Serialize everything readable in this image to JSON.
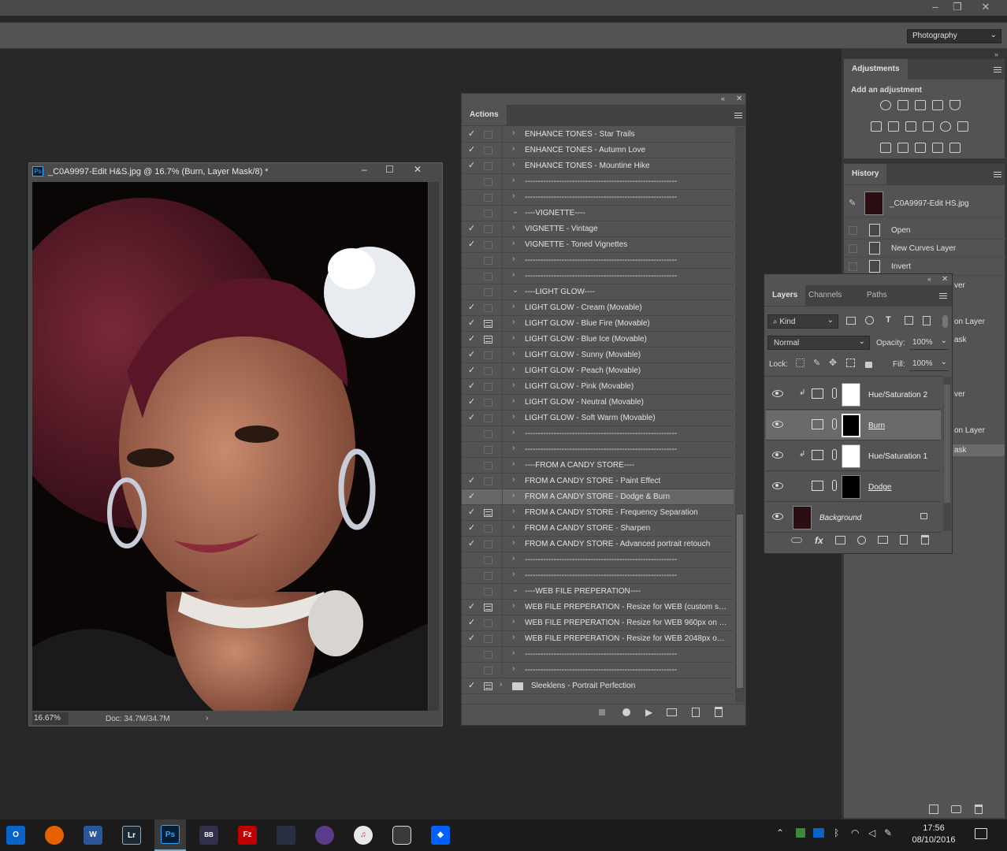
{
  "workspace": {
    "label": "Photography"
  },
  "document": {
    "title": "_C0A9997-Edit H&S.jpg @ 16.7% (Burn, Layer Mask/8) *",
    "zoom": "16.67%",
    "doc_size": "Doc: 34.7M/34.7M"
  },
  "actions": {
    "tab": "Actions",
    "rows": [
      {
        "check": "✓",
        "dialog": false,
        "arrow": "›",
        "label": "ENHANCE TONES - Star Trails"
      },
      {
        "check": "✓",
        "dialog": false,
        "arrow": "›",
        "label": "ENHANCE TONES - Autumn Love"
      },
      {
        "check": "✓",
        "dialog": false,
        "arrow": "›",
        "label": "ENHANCE TONES - Mountine Hike"
      },
      {
        "check": "",
        "dialog": false,
        "arrow": "›",
        "label": "----------------------------------------------------------"
      },
      {
        "check": "",
        "dialog": false,
        "arrow": "›",
        "label": "----------------------------------------------------------"
      },
      {
        "check": "",
        "dialog": false,
        "arrow": "⌄",
        "label": "----VIGNETTE----"
      },
      {
        "check": "✓",
        "dialog": false,
        "arrow": "›",
        "label": "VIGNETTE - Vintage"
      },
      {
        "check": "✓",
        "dialog": false,
        "arrow": "›",
        "label": "VIGNETTE - Toned Vignettes"
      },
      {
        "check": "",
        "dialog": false,
        "arrow": "›",
        "label": "----------------------------------------------------------"
      },
      {
        "check": "",
        "dialog": false,
        "arrow": "›",
        "label": "----------------------------------------------------------"
      },
      {
        "check": "",
        "dialog": false,
        "arrow": "⌄",
        "label": "----LIGHT GLOW----"
      },
      {
        "check": "✓",
        "dialog": false,
        "arrow": "›",
        "label": "LIGHT GLOW - Cream (Movable)"
      },
      {
        "check": "✓",
        "dialog": true,
        "arrow": "›",
        "label": "LIGHT GLOW - Blue Fire (Movable)"
      },
      {
        "check": "✓",
        "dialog": true,
        "arrow": "›",
        "label": "LIGHT GLOW - Blue Ice (Movable)"
      },
      {
        "check": "✓",
        "dialog": false,
        "arrow": "›",
        "label": "LIGHT GLOW - Sunny (Movable)"
      },
      {
        "check": "✓",
        "dialog": false,
        "arrow": "›",
        "label": "LIGHT GLOW - Peach (Movable)"
      },
      {
        "check": "✓",
        "dialog": false,
        "arrow": "›",
        "label": "LIGHT GLOW - Pink (Movable)"
      },
      {
        "check": "✓",
        "dialog": false,
        "arrow": "›",
        "label": "LIGHT GLOW - Neutral (Movable)"
      },
      {
        "check": "✓",
        "dialog": false,
        "arrow": "›",
        "label": "LIGHT GLOW - Soft Warm (Movable)"
      },
      {
        "check": "",
        "dialog": false,
        "arrow": "›",
        "label": "----------------------------------------------------------"
      },
      {
        "check": "",
        "dialog": false,
        "arrow": "›",
        "label": "----------------------------------------------------------"
      },
      {
        "check": "",
        "dialog": false,
        "arrow": "›",
        "label": "----FROM A CANDY STORE----"
      },
      {
        "check": "✓",
        "dialog": false,
        "arrow": "›",
        "label": "FROM A CANDY STORE - Paint Effect"
      },
      {
        "check": "✓",
        "dialog": false,
        "arrow": "›",
        "label": "FROM A CANDY STORE - Dodge & Burn",
        "selected": true
      },
      {
        "check": "✓",
        "dialog": true,
        "arrow": "›",
        "label": "FROM A CANDY STORE - Frequency Separation"
      },
      {
        "check": "✓",
        "dialog": false,
        "arrow": "›",
        "label": "FROM A CANDY STORE - Sharpen"
      },
      {
        "check": "✓",
        "dialog": false,
        "arrow": "›",
        "label": "FROM A CANDY STORE - Advanced portrait retouch"
      },
      {
        "check": "",
        "dialog": false,
        "arrow": "›",
        "label": "----------------------------------------------------------"
      },
      {
        "check": "",
        "dialog": false,
        "arrow": "›",
        "label": "----------------------------------------------------------"
      },
      {
        "check": "",
        "dialog": false,
        "arrow": "⌄",
        "label": "----WEB FILE PREPERATION----"
      },
      {
        "check": "✓",
        "dialog": true,
        "arrow": "›",
        "label": "WEB FILE PREPERATION - Resize for WEB (custom siz..."
      },
      {
        "check": "✓",
        "dialog": false,
        "arrow": "›",
        "label": "WEB FILE PREPERATION - Resize for WEB 960px on a..."
      },
      {
        "check": "✓",
        "dialog": false,
        "arrow": "›",
        "label": "WEB FILE PREPERATION - Resize for WEB 2048px on ..."
      },
      {
        "check": "",
        "dialog": false,
        "arrow": "›",
        "label": "----------------------------------------------------------"
      },
      {
        "check": "",
        "dialog": false,
        "arrow": "›",
        "label": "----------------------------------------------------------"
      }
    ],
    "set": {
      "check": "✓",
      "label": "Sleeklens - Portrait Perfection"
    }
  },
  "adjustments": {
    "tab": "Adjustments",
    "subtitle": "Add an adjustment"
  },
  "history": {
    "tab": "History",
    "snapshot": "_C0A9997-Edit HS.jpg",
    "items": [
      "Open",
      "New Curves Layer",
      "Invert"
    ],
    "hidden_partial": [
      "ver",
      "on Layer",
      "ask",
      "ver",
      "on Layer",
      "ask"
    ]
  },
  "layers": {
    "tabs": [
      "Layers",
      "Channels",
      "Paths"
    ],
    "filter": "Kind",
    "blend_mode": "Normal",
    "opacity_label": "Opacity:",
    "opacity": "100%",
    "lock_label": "Lock:",
    "fill_label": "Fill:",
    "fill": "100%",
    "items": [
      {
        "name": "Hue/Saturation 2",
        "mask": "#ffffff",
        "clip": true
      },
      {
        "name": "Burn",
        "mask": "#000000",
        "clip": false,
        "selected": true
      },
      {
        "name": "Hue/Saturation 1",
        "mask": "#ffffff",
        "clip": true
      },
      {
        "name": "Dodge",
        "mask": "#000000",
        "clip": false
      }
    ],
    "background": "Background"
  },
  "taskbar": {
    "time": "17:56",
    "date": "08/10/2016"
  }
}
